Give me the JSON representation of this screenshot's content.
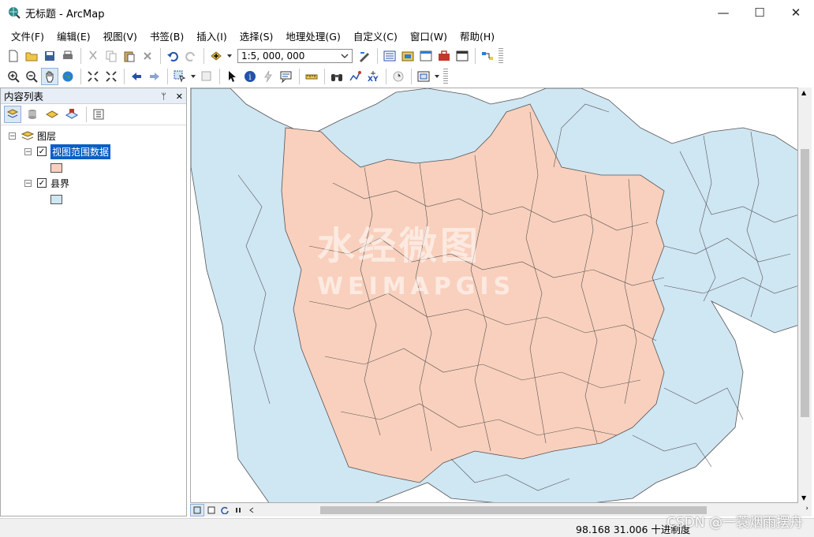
{
  "window": {
    "title": "无标题 - ArcMap",
    "minimize": "—",
    "maximize": "☐",
    "close": "✕"
  },
  "menu": [
    "文件(F)",
    "编辑(E)",
    "视图(V)",
    "书签(B)",
    "插入(I)",
    "选择(S)",
    "地理处理(G)",
    "自定义(C)",
    "窗口(W)",
    "帮助(H)"
  ],
  "toolbar": {
    "scale": "1:5, 000, 000"
  },
  "toc": {
    "title": "内容列表",
    "pin": "ᛘ",
    "close": "✕",
    "root": "图层",
    "layers": [
      {
        "name": "视图范围数据",
        "checked": true,
        "color": "#f9d0bd"
      },
      {
        "name": "县界",
        "checked": true,
        "color": "#cfe6f3"
      }
    ]
  },
  "map": {
    "extent_fill": "#f9d0bd",
    "county_fill": "#cfe6f3",
    "border": "#555555",
    "watermark_cn": "水经微图",
    "watermark_en": "WEIMAPGIS"
  },
  "status": {
    "coords": "98.168  31.006 十进制度"
  },
  "credit": "CSDN @一蓑烟雨摆舟"
}
